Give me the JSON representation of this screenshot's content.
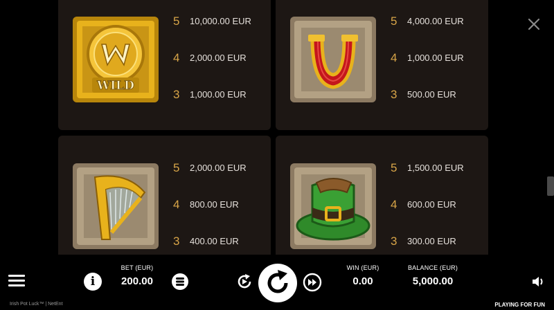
{
  "paytable": [
    {
      "symbol": "wild-symbol-icon",
      "pays": [
        {
          "count": "5",
          "amount": "10,000.00 EUR"
        },
        {
          "count": "4",
          "amount": "2,000.00 EUR"
        },
        {
          "count": "3",
          "amount": "1,000.00 EUR"
        }
      ]
    },
    {
      "symbol": "horseshoe-symbol-icon",
      "pays": [
        {
          "count": "5",
          "amount": "4,000.00 EUR"
        },
        {
          "count": "4",
          "amount": "1,000.00 EUR"
        },
        {
          "count": "3",
          "amount": "500.00 EUR"
        }
      ]
    },
    {
      "symbol": "harp-symbol-icon",
      "pays": [
        {
          "count": "5",
          "amount": "2,000.00 EUR"
        },
        {
          "count": "4",
          "amount": "800.00 EUR"
        },
        {
          "count": "3",
          "amount": "400.00 EUR"
        }
      ]
    },
    {
      "symbol": "leprechaun-hat-symbol-icon",
      "pays": [
        {
          "count": "5",
          "amount": "1,500.00 EUR"
        },
        {
          "count": "4",
          "amount": "600.00 EUR"
        },
        {
          "count": "3",
          "amount": "300.00 EUR"
        }
      ]
    }
  ],
  "wild_text": "WILD",
  "controls": {
    "bet_label": "BET (EUR)",
    "bet_value": "200.00",
    "win_label": "WIN (EUR)",
    "win_value": "0.00",
    "balance_label": "BALANCE (EUR)",
    "balance_value": "5,000.00",
    "info_glyph": "i"
  },
  "footer": {
    "game_info": "Irish Pot Luck™  |  NetEnt",
    "mode": "PLAYING FOR FUN"
  },
  "colors": {
    "pay_count": "#d8a548",
    "card_bg": "#1d1714",
    "gold": "#e8b21c"
  }
}
